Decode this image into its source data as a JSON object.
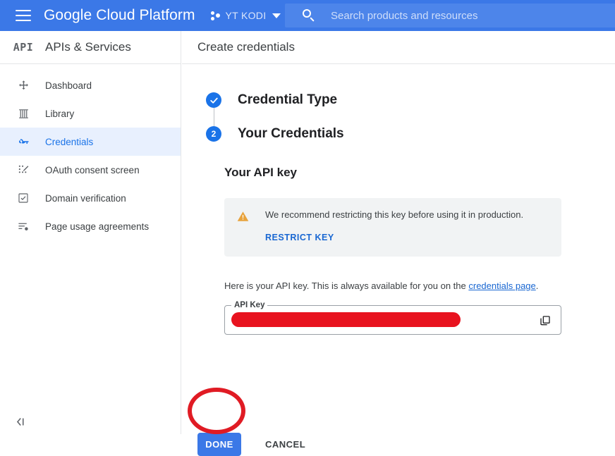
{
  "topbar": {
    "menu_icon": "hamburger-menu-icon",
    "brand": "Google Cloud Platform",
    "project": {
      "icon": "project-dots-icon",
      "name": "YT KODI",
      "chevron": "chevron-down-icon"
    },
    "search": {
      "icon": "search-icon",
      "value": "",
      "placeholder": "Search products and resources"
    },
    "colors": {
      "bar": "#3b78e7",
      "search_field": "#4d85ea"
    }
  },
  "sidebar": {
    "logo_text": "API",
    "title": "APIs & Services",
    "items": [
      {
        "label": "Dashboard",
        "icon": "dashboard-icon",
        "active": false
      },
      {
        "label": "Library",
        "icon": "library-icon",
        "active": false
      },
      {
        "label": "Credentials",
        "icon": "key-icon",
        "active": true
      },
      {
        "label": "OAuth consent screen",
        "icon": "oauth-consent-icon",
        "active": false
      },
      {
        "label": "Domain verification",
        "icon": "checkbox-icon",
        "active": false
      },
      {
        "label": "Page usage agreements",
        "icon": "page-settings-icon",
        "active": false
      }
    ],
    "collapse_icon": "collapse-sidebar-icon",
    "active_color": "#1a73e8",
    "active_bg": "#e8f0fe"
  },
  "main": {
    "title": "Create credentials",
    "steps": [
      {
        "marker": "check-icon",
        "number": "",
        "label": "Credential Type",
        "state": "completed"
      },
      {
        "marker": "number",
        "number": "2",
        "label": "Your Credentials",
        "state": "current"
      }
    ],
    "panel": {
      "heading": "Your API key",
      "warning": {
        "icon": "warning-triangle-icon",
        "text": "We recommend restricting this key before using it in production.",
        "link_label": "RESTRICT KEY",
        "bg": "#f1f3f4",
        "icon_color": "#e8a33d"
      },
      "description_before": "Here is your API key. This is always available for you on the ",
      "description_link": "credentials page",
      "description_after": ".",
      "api_key_field": {
        "label": "API Key",
        "value": "",
        "redacted": true,
        "redaction_color": "#e8131f",
        "copy_icon": "copy-icon"
      }
    },
    "actions": {
      "done_label": "DONE",
      "cancel_label": "CANCEL",
      "done_color": "#3b78e7"
    },
    "annotation": {
      "shape": "ellipse-highlight",
      "color": "#e01b24",
      "target": "DONE"
    }
  }
}
